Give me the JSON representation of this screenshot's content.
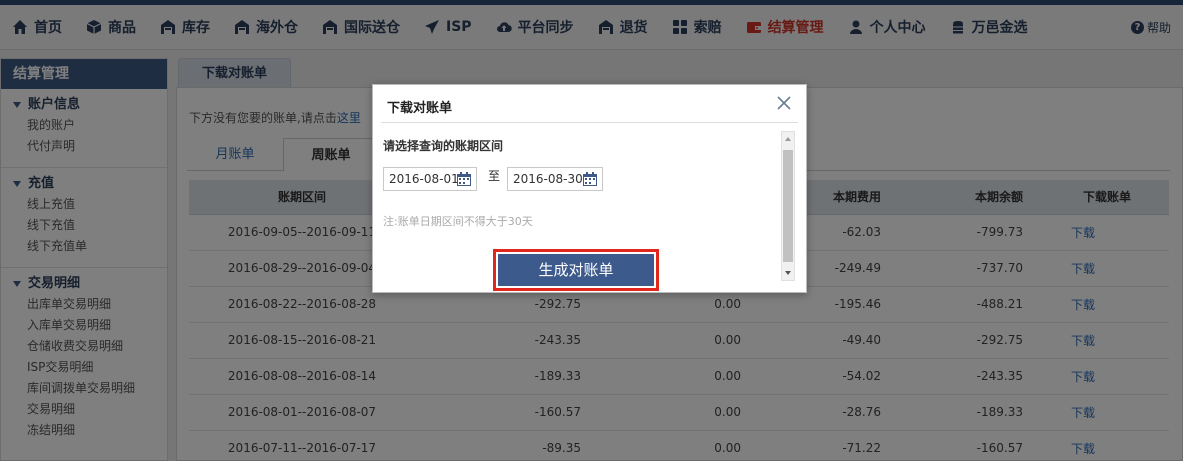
{
  "nav": {
    "items": [
      {
        "label": "首页",
        "icon": "home-icon"
      },
      {
        "label": "商品",
        "icon": "cube-icon"
      },
      {
        "label": "库存",
        "icon": "warehouse-icon"
      },
      {
        "label": "海外仓",
        "icon": "warehouse-icon"
      },
      {
        "label": "国际送仓",
        "icon": "warehouse-icon"
      },
      {
        "label": "ISP",
        "icon": "plane-icon"
      },
      {
        "label": "平台同步",
        "icon": "cloud-upload-icon"
      },
      {
        "label": "退货",
        "icon": "warehouse-icon"
      },
      {
        "label": "索赔",
        "icon": "grid-icon"
      },
      {
        "label": "结算管理",
        "icon": "wallet-icon"
      },
      {
        "label": "个人中心",
        "icon": "user-icon"
      },
      {
        "label": "万邑金选",
        "icon": "coins-icon"
      }
    ],
    "active_index": 9,
    "help_label": "帮助",
    "colors": {
      "bar_top": "#2f4a75",
      "active": "#d0352a",
      "text": "#2d3e5c"
    }
  },
  "sidebar": {
    "title": "结算管理",
    "groups": [
      {
        "title": "账户信息",
        "links": [
          "我的账户",
          "代付声明"
        ]
      },
      {
        "title": "充值",
        "links": [
          "线上充值",
          "线下充值",
          "线下充值单"
        ]
      },
      {
        "title": "交易明细",
        "links": [
          "出库单交易明细",
          "入库单交易明细",
          "仓储收费交易明细",
          "ISP交易明细",
          "库间调拨单交易明细",
          "交易明细",
          "冻结明细"
        ]
      }
    ]
  },
  "main": {
    "tab_label": "下载对账单",
    "hint_prefix": "下方没有您要的账单,请点击",
    "hint_link": "这里",
    "subtabs": [
      "月账单",
      "周账单"
    ],
    "selected_subtab": 1,
    "table": {
      "headers": [
        "账期区间",
        "",
        "",
        "本期费用",
        "本期余额",
        "下载账单"
      ],
      "rows": [
        [
          "2016-09-05--2016-09-11",
          "",
          "",
          "-62.03",
          "-799.73",
          "下载"
        ],
        [
          "2016-08-29--2016-09-04",
          "",
          "",
          "-249.49",
          "-737.70",
          "下载"
        ],
        [
          "2016-08-22--2016-08-28",
          "-292.75",
          "0.00",
          "-195.46",
          "-488.21",
          "下载"
        ],
        [
          "2016-08-15--2016-08-21",
          "-243.35",
          "0.00",
          "-49.40",
          "-292.75",
          "下载"
        ],
        [
          "2016-08-08--2016-08-14",
          "-189.33",
          "0.00",
          "-54.02",
          "-243.35",
          "下载"
        ],
        [
          "2016-08-01--2016-08-07",
          "-160.57",
          "0.00",
          "-28.76",
          "-189.33",
          "下载"
        ],
        [
          "2016-07-11--2016-07-17",
          "-89.35",
          "0.00",
          "-71.22",
          "-160.57",
          "下载"
        ]
      ]
    }
  },
  "modal": {
    "title": "下载对账单",
    "label": "请选择查询的账期区间",
    "date_from": "2016-08-01",
    "date_to": "2016-08-30",
    "to_label": "至",
    "note": "注:账单日期区间不得大于30天",
    "button_label": "生成对账单",
    "button_color": "#3c5a8c",
    "highlight_color": "#e2261c"
  }
}
